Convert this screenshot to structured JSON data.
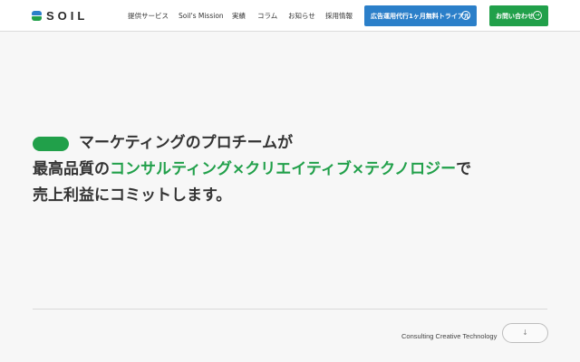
{
  "header": {
    "logo_text": "SOIL",
    "nav": [
      {
        "label": "提供サービス"
      },
      {
        "label": "Soil's Mission"
      },
      {
        "label": "実績"
      },
      {
        "label": "コラム"
      },
      {
        "label": "お知らせ"
      },
      {
        "label": "採用情報"
      }
    ],
    "trial_button": {
      "label": "広告運用代行1ヶ月無料トライアル",
      "icon": "arrow-circle-icon"
    },
    "contact_button": {
      "label": "お問い合わせ",
      "icon": "arrow-circle-icon"
    }
  },
  "hero": {
    "line1": "マーケティングのプロチームが",
    "line2_pre": "最高品質の",
    "line2_accent": "コンサルティング×クリエイティブ×テクノロジー",
    "line2_post": "で",
    "line3": "売上利益にコミットします。"
  },
  "footer": {
    "tagline": "Consulting Creative Technology",
    "scroll_icon": "↓"
  },
  "colors": {
    "brand_green": "#21a04a",
    "brand_blue": "#2b7fc9",
    "text": "#333333",
    "background": "#f7f7f7"
  }
}
